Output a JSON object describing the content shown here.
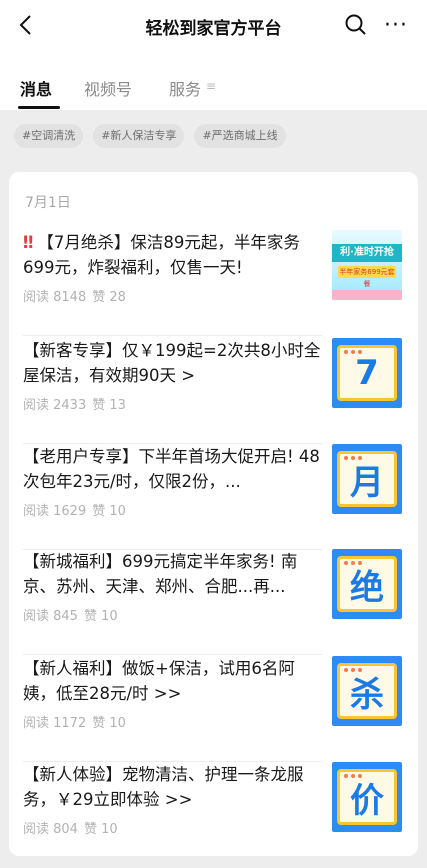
{
  "header": {
    "title": "轻松到家官方平台"
  },
  "tabs": [
    {
      "label": "消息"
    },
    {
      "label": "视频号"
    },
    {
      "label": "服务"
    }
  ],
  "tags": [
    "#空调清洗",
    "#新人保洁专享",
    "#严选商城上线"
  ],
  "date": "7月1日",
  "articles": [
    {
      "title": "【7月绝杀】保洁89元起，半年家务699元，炸裂福利，仅售一天!",
      "reads": "阅读 8148",
      "likes": "赞 28",
      "banner": "利·准时开抢",
      "banner_sub": "半年家务699元套餐"
    },
    {
      "title": "【新客专享】仅￥199起=2次共8小时全屋保洁，有效期90天 >",
      "reads": "阅读 2433",
      "likes": "赞 13",
      "glyph": "7"
    },
    {
      "title": "【老用户专享】下半年首场大促开启! 48次包年23元/时，仅限2份，...",
      "reads": "阅读 1629",
      "likes": "赞 10",
      "glyph": "月"
    },
    {
      "title": "【新城福利】699元搞定半年家务! 南京、苏州、天津、郑州、合肥...再...",
      "reads": "阅读 845",
      "likes": "赞 10",
      "glyph": "绝"
    },
    {
      "title": "【新人福利】做饭+保洁，试用6名阿姨，低至28元/时 >>",
      "reads": "阅读 1172",
      "likes": "赞 10",
      "glyph": "杀"
    },
    {
      "title": "【新人体验】宠物清洁、护理一条龙服务，￥29立即体验 >>",
      "reads": "阅读 804",
      "likes": "赞 10",
      "glyph": "价"
    }
  ]
}
